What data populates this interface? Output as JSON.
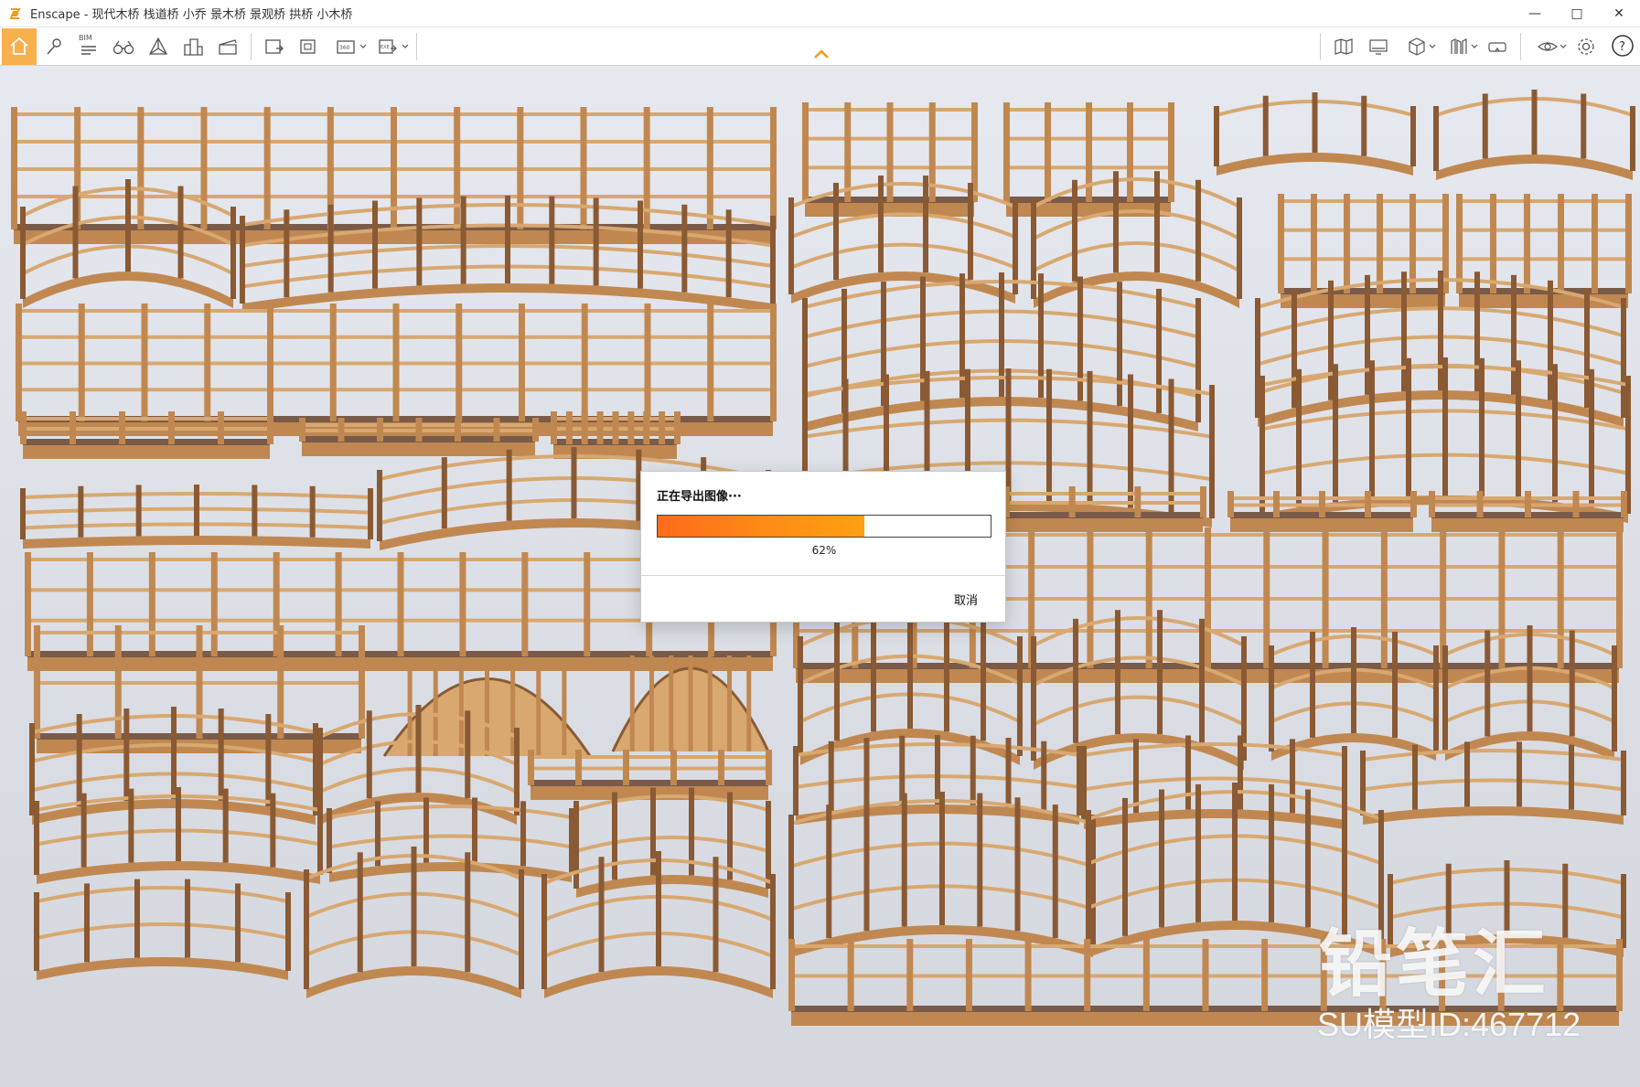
{
  "window": {
    "title": "Enscape - 现代木桥 栈道桥 小乔 景木桥 景观桥 拱桥 小木桥",
    "minimize": "—",
    "maximize": "□",
    "close": "✕"
  },
  "toolbar": {
    "bim_label": "BIM",
    "accent_color": "#f7b04b",
    "buttons": [
      "home-icon",
      "pin-icon",
      "bim-icon",
      "binoculars-icon",
      "perspective-icon",
      "buildings-icon",
      "clapboard-icon",
      "screenshot-icon",
      "batch-render-icon",
      "panorama-icon",
      "export-icon",
      "map-icon",
      "monitor-icon",
      "cube-icon",
      "asset-library-icon",
      "vr-headset-icon",
      "visibility-icon",
      "settings-icon",
      "help-icon"
    ]
  },
  "dialog": {
    "title": "正在导出图像···",
    "progress": 0.62,
    "progress_label": "62%",
    "cancel_label": "取消",
    "progress_color_start": "#ff6a1a",
    "progress_color_end": "#ffa012"
  },
  "watermark": {
    "brand": "铅笔汇",
    "model_id": "SU模型ID:467712"
  },
  "scene": {
    "wood_light": "#d8a870",
    "wood_mid": "#c08850",
    "wood_dark": "#8a5a34",
    "deck": "#7a5a48"
  }
}
